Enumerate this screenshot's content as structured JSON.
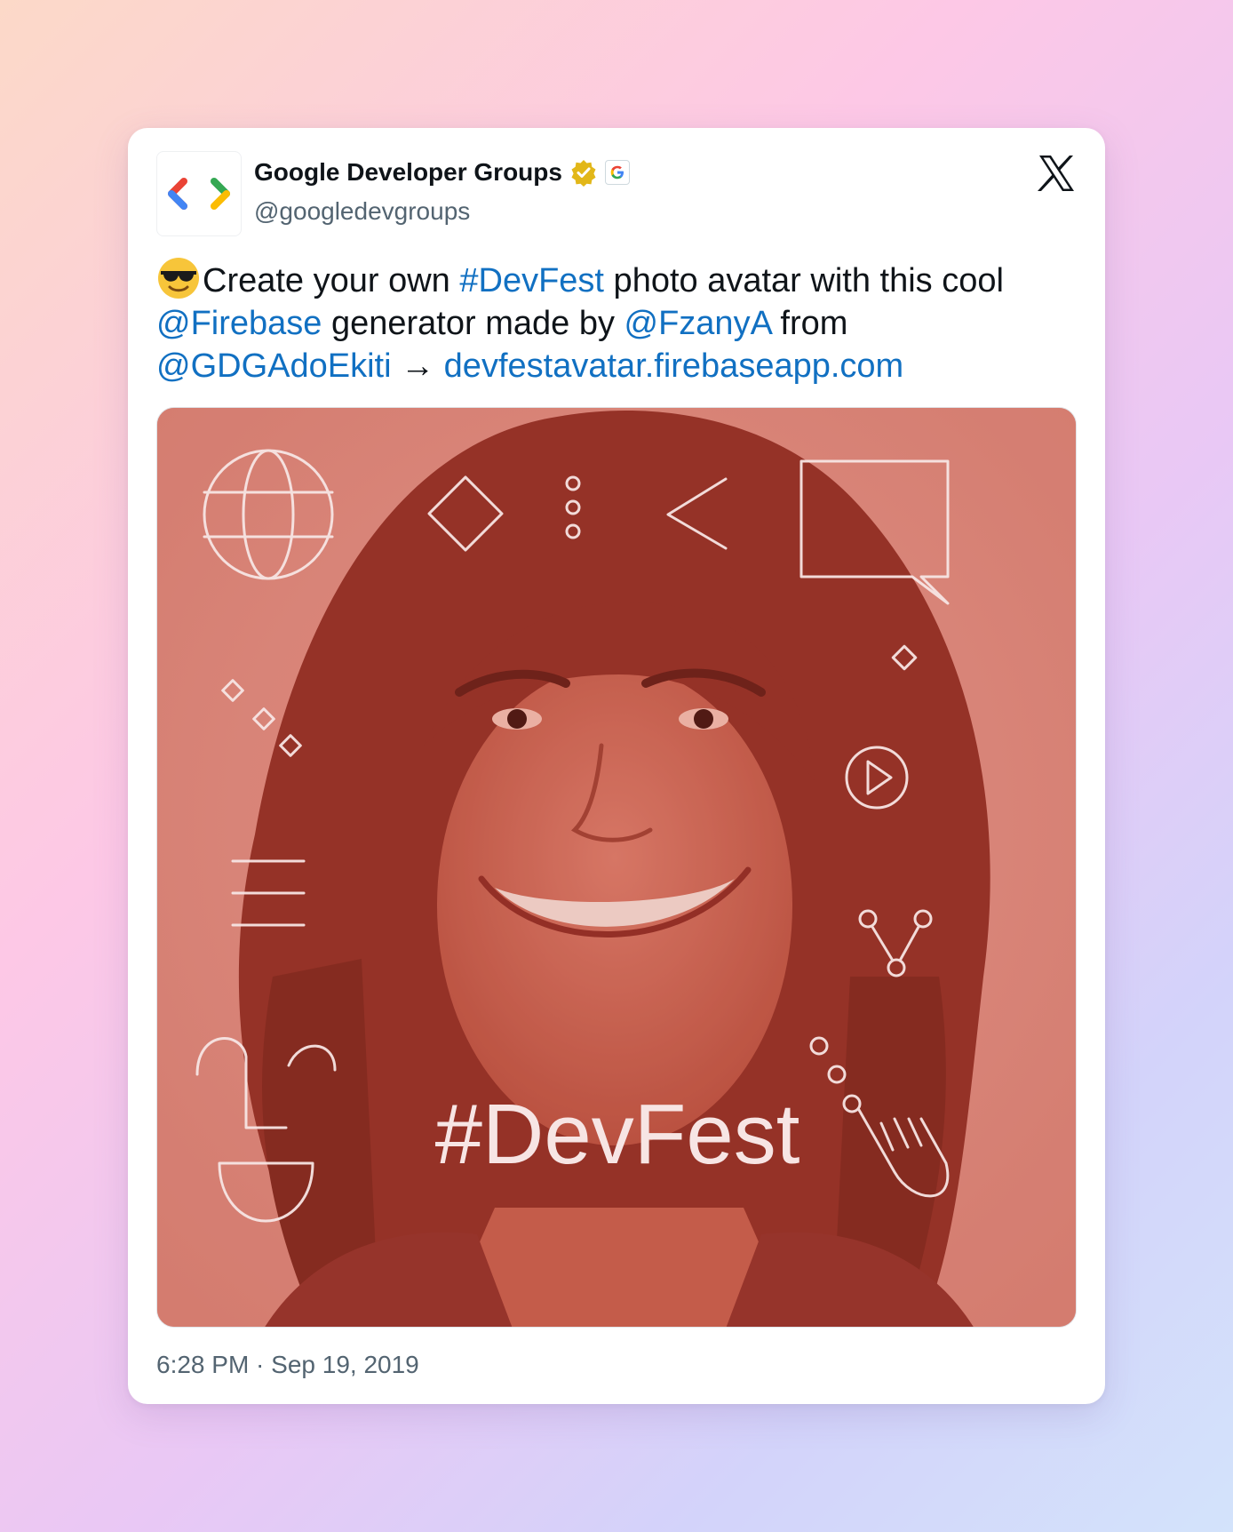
{
  "post": {
    "author_name": "Google Developer Groups",
    "handle": "@googledevgroups",
    "text": {
      "part1": "Create your own ",
      "hashtag": "#DevFest",
      "part2": " photo avatar with this cool ",
      "mention1": "@Firebase",
      "part3": " generator made by ",
      "mention2": "@FzanyA",
      "part4": " from ",
      "mention3": "@GDGAdoEkiti",
      "arrow": " → ",
      "url": "devfestavatar.firebaseapp.com"
    },
    "image_overlay_text": "#DevFest",
    "timestamp": "6:28 PM · Sep 19, 2019"
  },
  "colors": {
    "link": "#1170c2",
    "overlay": "#c9524a"
  },
  "icons": {
    "emoji": "sunglasses-face-icon",
    "verified": "gold-verified-badge-icon",
    "affiliate": "google-g-badge-icon",
    "platform": "x-logo-icon"
  }
}
